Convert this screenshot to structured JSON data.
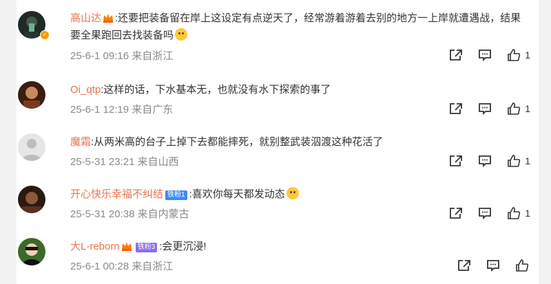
{
  "comments": [
    {
      "name": "高山达",
      "text": ":还要把装备留在岸上这设定有点逆天了，经常游着游着去别的地方一上岸就遭遇战，结果要全果跑回去找装备吗",
      "time": "25-6-1 09:16",
      "location": "来自浙江",
      "likes": "1"
    },
    {
      "name": "Oi_qtp",
      "text": ":这样的话，下水基本无，也就没有水下探索的事了",
      "time": "25-6-1 12:19",
      "location": "来自广东",
      "likes": "1"
    },
    {
      "name": "魔霜",
      "text": ":从两米高的台子上掉下去都能摔死，就别整武装泅渡这种花活了",
      "time": "25-5-31 23:21",
      "location": "来自山西",
      "likes": "1"
    },
    {
      "name": "开心快乐幸福不纠结",
      "fan_badge": "铁粉1",
      "text": ":喜欢你每天都发动态",
      "time": "25-5-31 20:38",
      "location": "来自内蒙古",
      "likes": "1"
    },
    {
      "name": "大L-reborn",
      "fan_badge": "铁粉3",
      "text": ":会更沉浸!",
      "time": "25-6-1 00:28",
      "location": "来自浙江",
      "likes": ""
    }
  ],
  "colors": {
    "username": "#eb7350",
    "meta": "#8a8a8a",
    "text": "#333333"
  },
  "icons": [
    "share-icon",
    "comment-icon",
    "like-icon",
    "crown-icon",
    "verified-badge-icon",
    "emoji-icon"
  ]
}
